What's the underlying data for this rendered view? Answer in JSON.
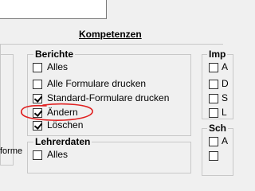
{
  "header": {
    "title": "Kompetenzen"
  },
  "left_panel": {
    "cut_text": "forme"
  },
  "groups": {
    "berichte": {
      "label": "Berichte",
      "items": [
        {
          "label": "Alles",
          "checked": false
        },
        {
          "label": "Alle Formulare drucken",
          "checked": false
        },
        {
          "label": "Standard-Formulare drucken",
          "checked": true
        },
        {
          "label": "Ändern",
          "checked": true
        },
        {
          "label": "Löschen",
          "checked": true
        }
      ]
    },
    "lehrerdaten": {
      "label": "Lehrerdaten",
      "items": [
        {
          "label": "Alles",
          "checked": false
        }
      ]
    },
    "right_top": {
      "label": "Imp",
      "items": [
        {
          "label": "A"
        },
        {
          "label": "D"
        },
        {
          "label": "S"
        },
        {
          "label": "L"
        }
      ]
    },
    "right_bottom": {
      "label": "Sch",
      "items": [
        {
          "label": "A"
        },
        {
          "label": ""
        }
      ]
    }
  },
  "annotation": {
    "color": "#e02020"
  }
}
